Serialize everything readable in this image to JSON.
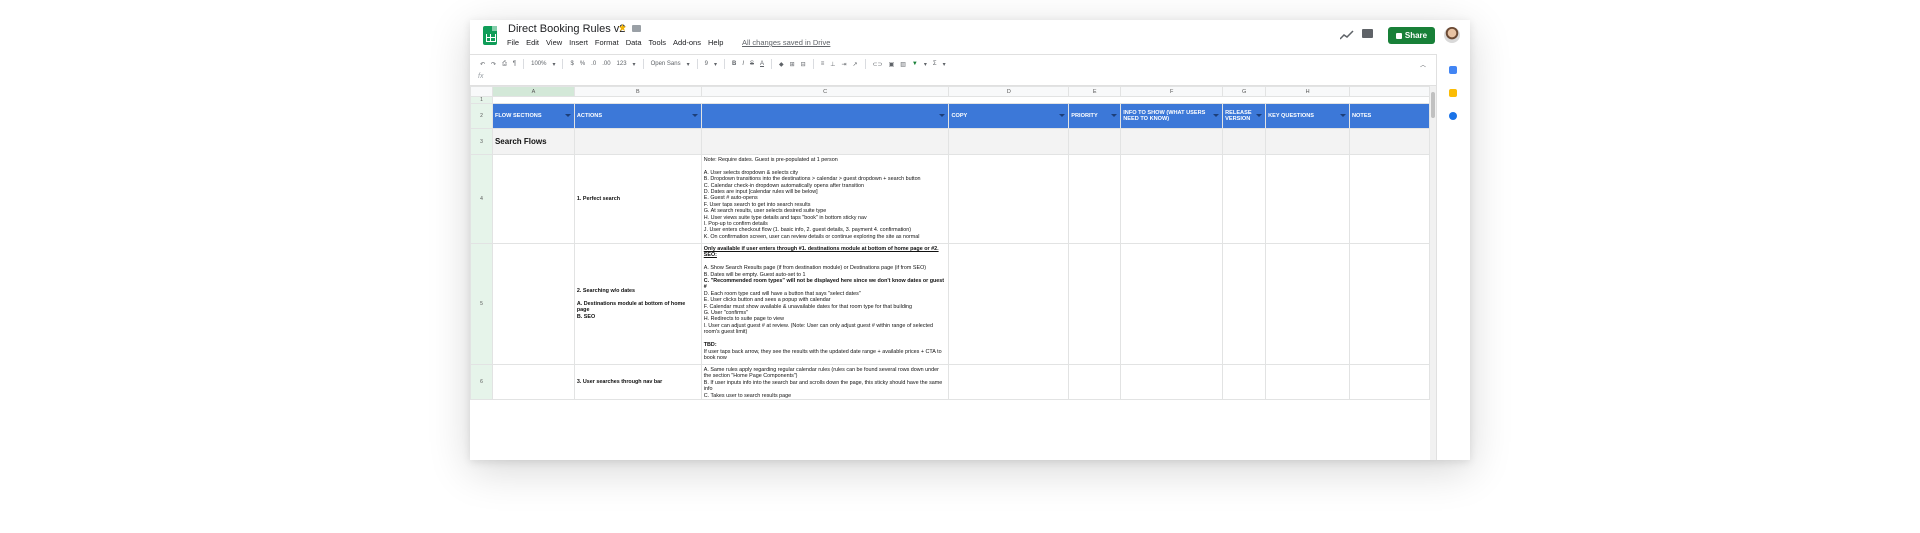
{
  "doc": {
    "title": "Direct Booking Rules v2",
    "saved_status": "All changes saved in Drive",
    "share_label": "Share",
    "menu": [
      "File",
      "Edit",
      "View",
      "Insert",
      "Format",
      "Data",
      "Tools",
      "Add-ons",
      "Help"
    ]
  },
  "toolbar": {
    "zoom": "100%",
    "currency": "$",
    "percent": "%",
    "decimal_less": ".0",
    "decimal_more": ".00",
    "format_more": "123",
    "font": "Open Sans",
    "font_size": "9",
    "bold": "B",
    "italic": "I",
    "strike": "S",
    "text_color": "A",
    "functions": "Σ"
  },
  "formula_bar": {
    "fx": "fx"
  },
  "columns": [
    "A",
    "B",
    "C",
    "D",
    "E",
    "F",
    "G",
    "H"
  ],
  "rows": [
    "1",
    "2",
    "3",
    "4",
    "5",
    "6"
  ],
  "headers": [
    "FLOW SECTIONS",
    "ACTIONS",
    "",
    "COPY",
    "PRIORITY",
    "INFO TO SHOW (WHAT USERS NEED TO KNOW)",
    "RELEASE VERSION",
    "KEY QUESTIONS",
    "NOTES"
  ],
  "section": {
    "title": "Search Flows"
  },
  "entries": [
    {
      "flow": "1. Perfect search",
      "actions": [
        "Note: Require dates. Guest is pre-populated at 1 person",
        "",
        "A. User selects dropdown & selects city",
        "B. Dropdown transitions into the destinations > calendar > guest dropdown + search button",
        "C. Calendar check-in dropdown automatically opens after transition",
        "D. Dates are input [calendar rules will be below]",
        "E. Guest # auto-opens",
        "F. User taps search to get into search results",
        "G. At search results, user selects desired suite type",
        "H. User views suite type details and taps \"book\" in bottom sticky nav",
        "I. Pop-up to confirm details",
        "J. User enters checkout flow (1. basic info, 2. guest details, 3. payment 4. confirmation)",
        "K. On confirmation screen, user can review details or continue exploring the site as normal"
      ]
    },
    {
      "flow_lines": [
        "2. Searching w/o dates",
        "",
        "A. Destinations module at bottom of home page",
        "B. SEO"
      ],
      "actions": [
        "Only available if user enters through #1. destinations module at bottom of home page or #2. SEO:",
        "",
        "A. Show Search Results page (if from destination module) or Destinations page (if from SEO)",
        "B. Dates will be empty. Guest auto-set to 1",
        "C. \"Recommended room types\" will not be displayed here since we don't know dates or guest #",
        "D. Each room type card will have a button that says \"select dates\"",
        "E. User clicks button and sees a popup with calendar",
        "F. Calendar must show available & unavailable dates for that room type for that building",
        "G. User \"confirms\"",
        "H. Redirects to suite page to view",
        "I. User can adjust guest # at review. (Note: User can only adjust guest # within range of selected room's guest limit)",
        "",
        "TBD:",
        "If user taps back arrow, they see the results with the updated date range + available prices + CTA to book now"
      ]
    },
    {
      "flow": "3. User searches through nav bar",
      "actions": [
        "A. Same rules apply regarding regular calendar rules (rules can be found several rows down under the section \"Home Page Components\")",
        "B. If user inputs info into the search bar and scrolls down the page, this sticky should have the same info",
        "C. Takes user to search results page"
      ]
    }
  ],
  "colors": {
    "header_blue": "#3c78d8",
    "share_green": "#188038",
    "sheets_green": "#0f9d58"
  }
}
